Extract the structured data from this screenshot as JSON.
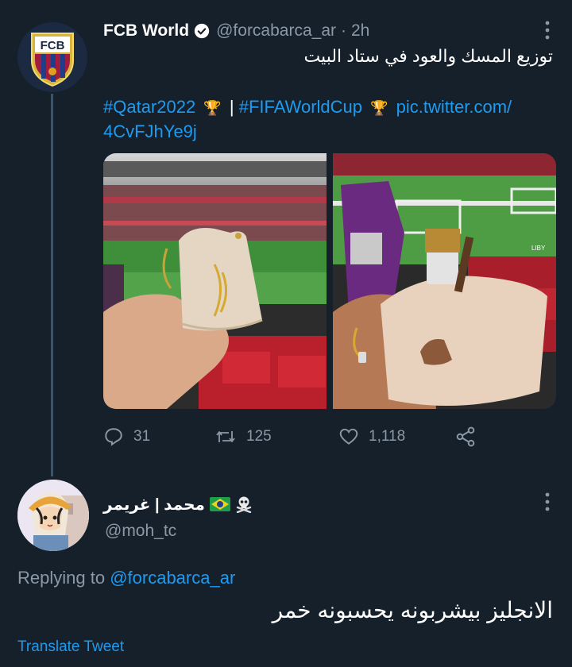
{
  "tweet": {
    "display_name": "FCB World",
    "handle": "@forcabarca_ar",
    "separator": "·",
    "time": "2h",
    "text": "توزيع المسك والعود في ستاد البيت",
    "hashtag1": "#Qatar2022",
    "hashtag_sep": "|",
    "hashtag2": "#FIFAWorldCup",
    "link_part1": "pic.twitter.com/",
    "link_part2": "4CvFJhYe9j",
    "avatar_text": "FCB",
    "photo2_label": "LIBY",
    "replies": "31",
    "retweets": "125",
    "likes": "1,118"
  },
  "reply": {
    "display_name": "محمد | غريمر",
    "handle": "@moh_tc",
    "replying_prefix": "Replying to",
    "replying_to": "@forcabarca_ar",
    "text": "الانجليز بيشربونه يحسبونه خمر",
    "translate_label": "Translate Tweet"
  },
  "colors": {
    "background": "#15202b",
    "link": "#1d9bf0",
    "muted": "#8b98a5",
    "thread_line": "#3d5466"
  },
  "icons": [
    "verified-badge-icon",
    "more-options-icon",
    "reply-icon",
    "retweet-icon",
    "like-icon",
    "share-icon",
    "trophy-icon",
    "brazil-flag-icon",
    "skull-crossbones-icon"
  ]
}
